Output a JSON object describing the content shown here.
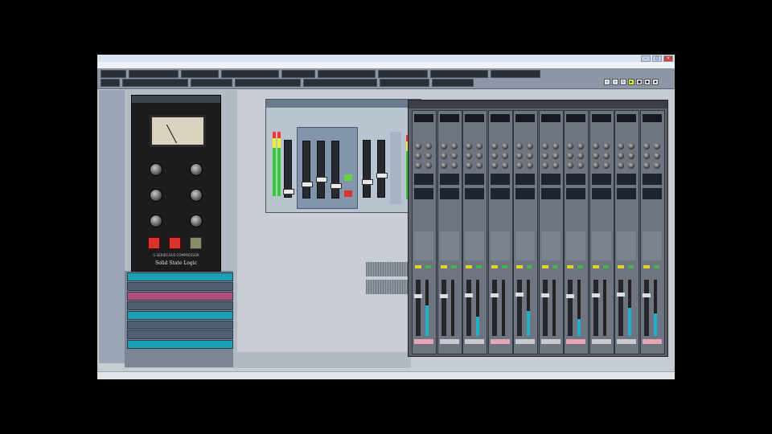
{
  "colors": {
    "accent_cyan": "#1bb3c9",
    "accent_yellow": "#e3d227",
    "record_red": "#d8352f",
    "active_green": "#46b34a"
  },
  "plugins": {
    "compressor": {
      "model": "G SERIES BUS COMPRESSOR",
      "brand": "Solid State Logic"
    }
  },
  "mixer": {
    "channel_count": 10,
    "fader_levels": [
      0.72,
      0.72,
      0.75,
      0.75,
      0.76,
      0.74,
      0.72,
      0.74,
      0.76,
      0.75
    ],
    "meter_levels": [
      0.55,
      0.0,
      0.35,
      0.0,
      0.45,
      0.0,
      0.3,
      0.0,
      0.5,
      0.4
    ]
  },
  "icons": {
    "close": "close-icon",
    "minimize": "minimize-icon",
    "maximize": "maximize-icon",
    "play": "play-icon",
    "stop": "stop-icon",
    "record": "record-icon"
  }
}
